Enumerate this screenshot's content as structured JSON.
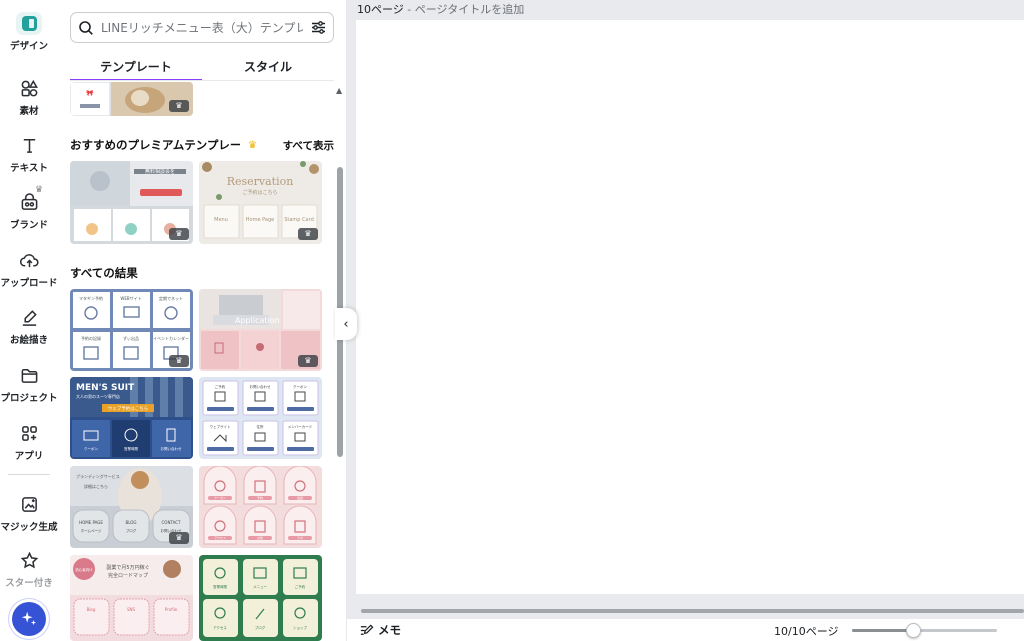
{
  "rail": {
    "items": [
      {
        "label": "デザイン",
        "icon": "design-icon"
      },
      {
        "label": "素材",
        "icon": "elements-icon"
      },
      {
        "label": "テキスト",
        "icon": "text-icon"
      },
      {
        "label": "ブランド",
        "icon": "brand-icon"
      },
      {
        "label": "アップロード",
        "icon": "upload-icon"
      },
      {
        "label": "お絵描き",
        "icon": "draw-icon"
      },
      {
        "label": "プロジェクト",
        "icon": "folder-icon"
      },
      {
        "label": "アプリ",
        "icon": "apps-icon"
      },
      {
        "label": "マジック生成",
        "icon": "magic-media-icon"
      },
      {
        "label": "スター付き",
        "icon": "star-icon"
      }
    ]
  },
  "panel": {
    "search_placeholder": "LINEリッチメニュー表（大）テンプレート",
    "tabs": [
      {
        "label": "テンプレート",
        "active": true
      },
      {
        "label": "スタイル",
        "active": false
      }
    ],
    "premium_section": {
      "title": "おすすめのプレミアムテンプレート",
      "link": "すべて表示"
    },
    "results_section": {
      "title": "すべての結果"
    },
    "premium_templates": [
      {
        "title": "無料相談会を",
        "items": [
          "",
          "",
          ""
        ]
      },
      {
        "title": "Reservation",
        "subtitle": "ご予約はこちら",
        "items": [
          "Menu",
          "Home Page",
          "Stamp Card"
        ]
      }
    ],
    "result_templates": [
      {
        "items": [
          "マタギン予約",
          "WEBサイト",
          "定期でネット",
          "予約の記録",
          "ずぃ出品",
          "イベントカレンダー"
        ]
      },
      {
        "title": "Application",
        "items": [
          "",
          "",
          ""
        ]
      },
      {
        "title": "MEN'S SUIT",
        "subtitle": "大人の男のスーツ専門店",
        "cta": "ウェブ予約はこちら",
        "items": [
          "クーポン",
          "営業時間",
          "お問い合わせ"
        ]
      },
      {
        "items": [
          "ご予約",
          "お問い合わせ",
          "クーポン",
          "ウェブサイト",
          "住所",
          "メンバーカード"
        ]
      },
      {
        "title": "ブランディングサービス",
        "subtitle": "詳細はこちら",
        "items": [
          "HOME PAGE",
          "BLOG",
          "CONTACT"
        ],
        "sub_items": [
          "ホームページ",
          "ブログ",
          "お問い合わせ"
        ]
      },
      {
        "items": [
          "クーポン",
          "予約",
          "電話",
          "アクセス",
          "お知",
          "ラボ"
        ]
      },
      {
        "title": "副業で月5万円稼ぐ",
        "subtitle": "完全ロードマップ",
        "badge": "初心者向け",
        "items": [
          "Blog",
          "SNS",
          "Profile"
        ]
      },
      {
        "items": [
          "営業時間",
          "メニュー",
          "ご予約",
          "アクセス",
          "ブログ",
          "ショップ"
        ]
      }
    ]
  },
  "editor": {
    "page_number": "10ページ",
    "page_title_placeholder": "- ページタイトルを追加",
    "memo_label": "メモ",
    "page_count": "10/10ページ",
    "zoom_level": 0.42
  },
  "colors": {
    "accent": "#8b3dff",
    "canva_blue": "#3653d6",
    "canvas_bg": "#e8eaed"
  }
}
